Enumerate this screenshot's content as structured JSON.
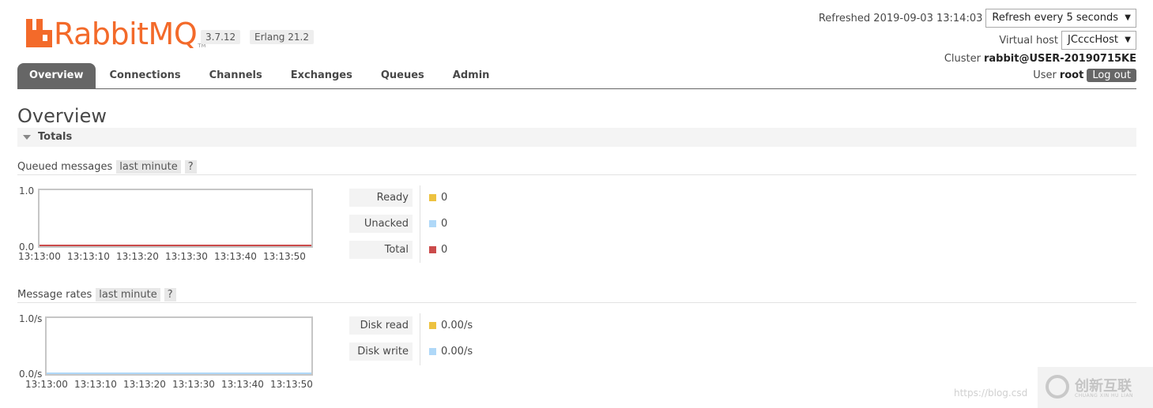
{
  "brand": {
    "logo_text": "RabbitMQ",
    "logo_tm": "TM",
    "version": "3.7.12",
    "erlang": "Erlang 21.2",
    "accent_color": "#f36a2a"
  },
  "status": {
    "refreshed_label": "Refreshed 2019-09-03 13:14:03",
    "refresh_select": "Refresh every 5 seconds",
    "vhost_label": "Virtual host",
    "vhost_select": "JCcccHost",
    "cluster_label": "Cluster",
    "cluster_value": "rabbit@USER-20190715KE",
    "user_label": "User",
    "user_value": "root",
    "logout_label": "Log out"
  },
  "tabs": [
    {
      "label": "Overview",
      "active": true
    },
    {
      "label": "Connections"
    },
    {
      "label": "Channels"
    },
    {
      "label": "Exchanges"
    },
    {
      "label": "Queues"
    },
    {
      "label": "Admin"
    }
  ],
  "page": {
    "title": "Overview",
    "section": "Totals"
  },
  "queued": {
    "heading": "Queued messages",
    "range": "last minute",
    "help": "?",
    "y_max": "1.0",
    "y_min": "0.0",
    "ticks": [
      "13:13:00",
      "13:13:10",
      "13:13:20",
      "13:13:30",
      "13:13:40",
      "13:13:50"
    ],
    "legend": [
      {
        "label": "Ready",
        "value": "0",
        "color": "#edc240"
      },
      {
        "label": "Unacked",
        "value": "0",
        "color": "#afd8f8"
      },
      {
        "label": "Total",
        "value": "0",
        "color": "#cb4b4b"
      }
    ]
  },
  "rates": {
    "heading": "Message rates",
    "range": "last minute",
    "help": "?",
    "y_max": "1.0/s",
    "y_min": "0.0/s",
    "ticks": [
      "13:13:00",
      "13:13:10",
      "13:13:20",
      "13:13:30",
      "13:13:40",
      "13:13:50"
    ],
    "legend": [
      {
        "label": "Disk read",
        "value": "0.00/s",
        "color": "#edc240"
      },
      {
        "label": "Disk write",
        "value": "0.00/s",
        "color": "#afd8f8"
      }
    ]
  },
  "watermark": {
    "url": "https://blog.csd",
    "brand": "创新互联",
    "sub": "CHUANG XIN HU LIAN"
  }
}
